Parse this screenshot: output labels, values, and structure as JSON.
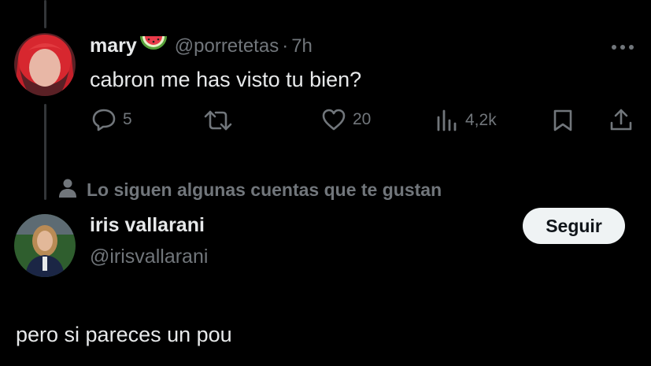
{
  "tweet": {
    "author_name": "mary",
    "author_emoji": "watermelon-icon",
    "handle": "@porretetas",
    "separator": "·",
    "time": "7h",
    "text": "cabron me has visto tu bien?",
    "actions": {
      "replies": "5",
      "retweets": "",
      "likes": "20",
      "views": "4,2k"
    }
  },
  "suggestion": {
    "context_text": "Lo siguen algunas cuentas que te gustan",
    "name": "iris vallarani",
    "handle": "@irisvallarani",
    "follow_label": "Seguir"
  },
  "reply_text": "pero si pareces un pou",
  "colors": {
    "background": "#000000",
    "text": "#e7e9ea",
    "muted": "#71767b",
    "button_bg": "#eff3f4",
    "button_text": "#0f1419",
    "thread_line": "#333639"
  }
}
